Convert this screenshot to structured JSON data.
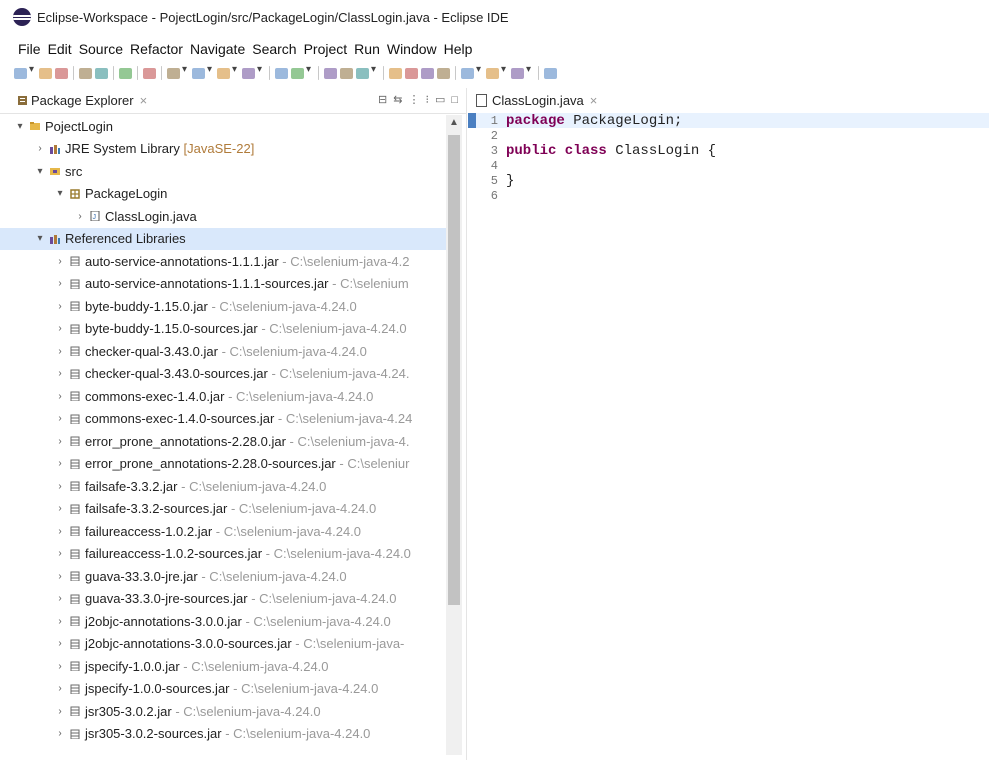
{
  "window": {
    "title": "Eclipse-Workspace - PojectLogin/src/PackageLogin/ClassLogin.java - Eclipse IDE"
  },
  "menu": [
    "File",
    "Edit",
    "Source",
    "Refactor",
    "Navigate",
    "Search",
    "Project",
    "Run",
    "Window",
    "Help"
  ],
  "colors": {
    "keyword": "#7f0055",
    "path": "#999999",
    "jre_tag": "#b07b3a",
    "highlight_line": "#e8f2fe",
    "selection": "#d9e8fb"
  },
  "package_explorer": {
    "tab_label": "Package Explorer",
    "close_glyph": "×",
    "project": "PojectLogin",
    "jre": {
      "name": "JRE System Library",
      "tag": "[JavaSE-22]"
    },
    "src": "src",
    "package": "PackageLogin",
    "class_file": "ClassLogin.java",
    "referenced_libraries": "Referenced Libraries",
    "jars": [
      {
        "name": "auto-service-annotations-1.1.1.jar",
        "path": "- C:\\selenium-java-4.2"
      },
      {
        "name": "auto-service-annotations-1.1.1-sources.jar",
        "path": "- C:\\selenium"
      },
      {
        "name": "byte-buddy-1.15.0.jar",
        "path": "- C:\\selenium-java-4.24.0"
      },
      {
        "name": "byte-buddy-1.15.0-sources.jar",
        "path": "- C:\\selenium-java-4.24.0"
      },
      {
        "name": "checker-qual-3.43.0.jar",
        "path": "- C:\\selenium-java-4.24.0"
      },
      {
        "name": "checker-qual-3.43.0-sources.jar",
        "path": "- C:\\selenium-java-4.24."
      },
      {
        "name": "commons-exec-1.4.0.jar",
        "path": "- C:\\selenium-java-4.24.0"
      },
      {
        "name": "commons-exec-1.4.0-sources.jar",
        "path": "- C:\\selenium-java-4.24"
      },
      {
        "name": "error_prone_annotations-2.28.0.jar",
        "path": "- C:\\selenium-java-4."
      },
      {
        "name": "error_prone_annotations-2.28.0-sources.jar",
        "path": "- C:\\seleniur"
      },
      {
        "name": "failsafe-3.3.2.jar",
        "path": "- C:\\selenium-java-4.24.0"
      },
      {
        "name": "failsafe-3.3.2-sources.jar",
        "path": "- C:\\selenium-java-4.24.0"
      },
      {
        "name": "failureaccess-1.0.2.jar",
        "path": "- C:\\selenium-java-4.24.0"
      },
      {
        "name": "failureaccess-1.0.2-sources.jar",
        "path": "- C:\\selenium-java-4.24.0"
      },
      {
        "name": "guava-33.3.0-jre.jar",
        "path": "- C:\\selenium-java-4.24.0"
      },
      {
        "name": "guava-33.3.0-jre-sources.jar",
        "path": "- C:\\selenium-java-4.24.0"
      },
      {
        "name": "j2objc-annotations-3.0.0.jar",
        "path": "- C:\\selenium-java-4.24.0"
      },
      {
        "name": "j2objc-annotations-3.0.0-sources.jar",
        "path": "- C:\\selenium-java-"
      },
      {
        "name": "jspecify-1.0.0.jar",
        "path": "- C:\\selenium-java-4.24.0"
      },
      {
        "name": "jspecify-1.0.0-sources.jar",
        "path": "- C:\\selenium-java-4.24.0"
      },
      {
        "name": "jsr305-3.0.2.jar",
        "path": "- C:\\selenium-java-4.24.0"
      },
      {
        "name": "jsr305-3.0.2-sources.jar",
        "path": "- C:\\selenium-java-4.24.0"
      }
    ]
  },
  "editor": {
    "tab_label": "ClassLogin.java",
    "close_glyph": "×",
    "lines": [
      {
        "num": "1",
        "kw": "package",
        "rest": " PackageLogin;"
      },
      {
        "num": "2",
        "kw": "",
        "rest": ""
      },
      {
        "num": "3",
        "kw": "public class",
        "rest": " ClassLogin {"
      },
      {
        "num": "4",
        "kw": "",
        "rest": ""
      },
      {
        "num": "5",
        "kw": "",
        "rest": "}"
      },
      {
        "num": "6",
        "kw": "",
        "rest": ""
      }
    ]
  },
  "icons": {
    "toolbar": [
      "new-icon",
      "dropdown",
      "save-icon",
      "save-all-icon",
      "sep",
      "undo-icon",
      "redo-icon",
      "sep",
      "terminal-icon",
      "sep",
      "skip-icon",
      "sep",
      "debug-icon",
      "dropdown",
      "run-icon",
      "dropdown",
      "run-config-icon",
      "dropdown",
      "external-tools-icon",
      "dropdown",
      "sep",
      "new-java-project-icon",
      "new-package-icon",
      "dropdown",
      "sep",
      "open-type-icon",
      "search-icon",
      "pin-icon",
      "dropdown",
      "sep",
      "next-annotation-icon",
      "prev-annotation-icon",
      "toggle-breadcrumb-icon",
      "toggle-mark-icon",
      "sep",
      "last-edit-icon",
      "dropdown",
      "back-icon",
      "dropdown",
      "forward-icon",
      "dropdown",
      "sep",
      "open-perspective-icon"
    ]
  }
}
